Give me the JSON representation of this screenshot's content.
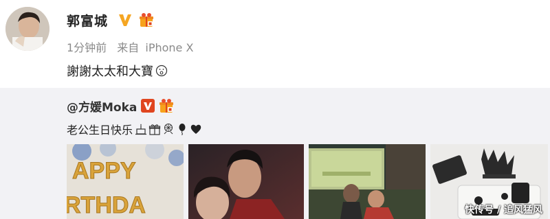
{
  "post": {
    "author": "郭富城",
    "timestamp": "1分钟前",
    "source_prefix": "来自",
    "source_device": "iPhone X",
    "text": "謝謝太太和大寶",
    "verified_icon": "v-badge-icon",
    "gift_icon": "gift-badge-icon"
  },
  "repost": {
    "author": "@方媛Moka",
    "text": "老公生日快乐",
    "emoji_icons": [
      "cake-icon",
      "gift-icon",
      "fireworks-icon",
      "balloon-icon",
      "heart-icon"
    ]
  },
  "photos": [
    {
      "name": "birthday-banner-photo",
      "text_lines": [
        "APPY",
        "RTHDA"
      ]
    },
    {
      "name": "couple-selfie-photo"
    },
    {
      "name": "party-screen-photo"
    },
    {
      "name": "birthday-cake-photo"
    }
  ],
  "watermark": "快传号 / 追风猛风",
  "colors": {
    "verified_orange": "#f5a623",
    "repost_bg": "#f2f2f5",
    "meta_gray": "#8a8a8a"
  }
}
